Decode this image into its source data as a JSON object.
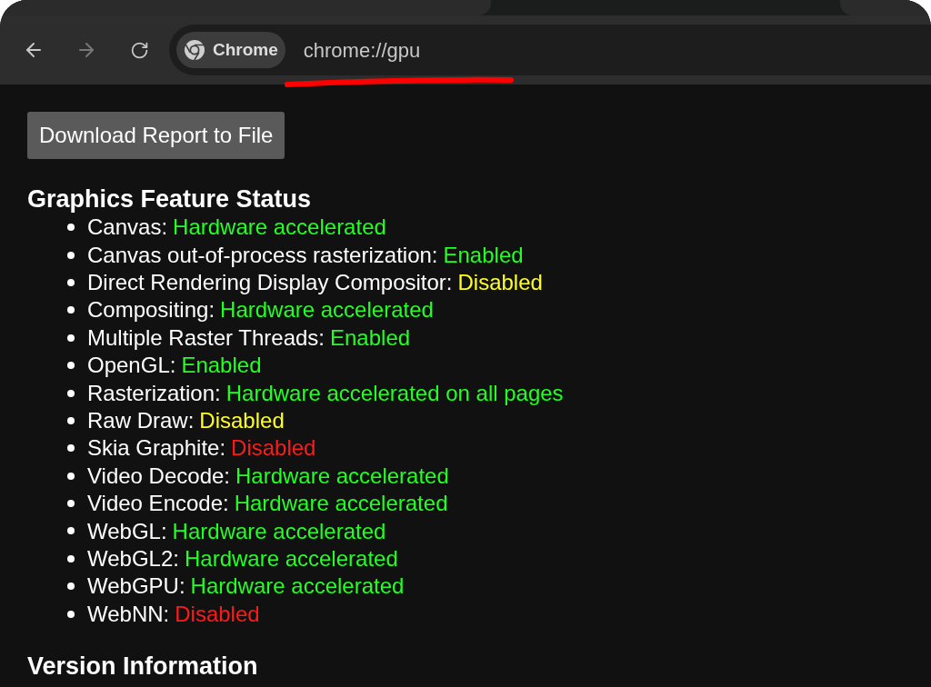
{
  "toolbar": {
    "chip_label": "Chrome",
    "address": "chrome://gpu"
  },
  "download_button": "Download Report to File",
  "sections": [
    {
      "title": "Graphics Feature Status",
      "items": [
        {
          "name": "Canvas:",
          "status": "Hardware accelerated",
          "color": "#22ff22"
        },
        {
          "name": "Canvas out-of-process rasterization:",
          "status": "Enabled",
          "color": "#22ff22"
        },
        {
          "name": "Direct Rendering Display Compositor:",
          "status": "Disabled",
          "color": "#ffff22"
        },
        {
          "name": "Compositing:",
          "status": "Hardware accelerated",
          "color": "#22ff22"
        },
        {
          "name": "Multiple Raster Threads:",
          "status": "Enabled",
          "color": "#22ff22"
        },
        {
          "name": "OpenGL:",
          "status": "Enabled",
          "color": "#22ff22"
        },
        {
          "name": "Rasterization:",
          "status": "Hardware accelerated on all pages",
          "color": "#22ff22"
        },
        {
          "name": "Raw Draw:",
          "status": "Disabled",
          "color": "#ffff22"
        },
        {
          "name": "Skia Graphite:",
          "status": "Disabled",
          "color": "#ff1a1a"
        },
        {
          "name": "Video Decode:",
          "status": "Hardware accelerated",
          "color": "#22ff22"
        },
        {
          "name": "Video Encode:",
          "status": "Hardware accelerated",
          "color": "#22ff22"
        },
        {
          "name": "WebGL:",
          "status": "Hardware accelerated",
          "color": "#22ff22"
        },
        {
          "name": "WebGL2:",
          "status": "Hardware accelerated",
          "color": "#22ff22"
        },
        {
          "name": "WebGPU:",
          "status": "Hardware accelerated",
          "color": "#22ff22"
        },
        {
          "name": "WebNN:",
          "status": "Disabled",
          "color": "#ff1a1a"
        }
      ]
    },
    {
      "title": "Version Information"
    }
  ]
}
